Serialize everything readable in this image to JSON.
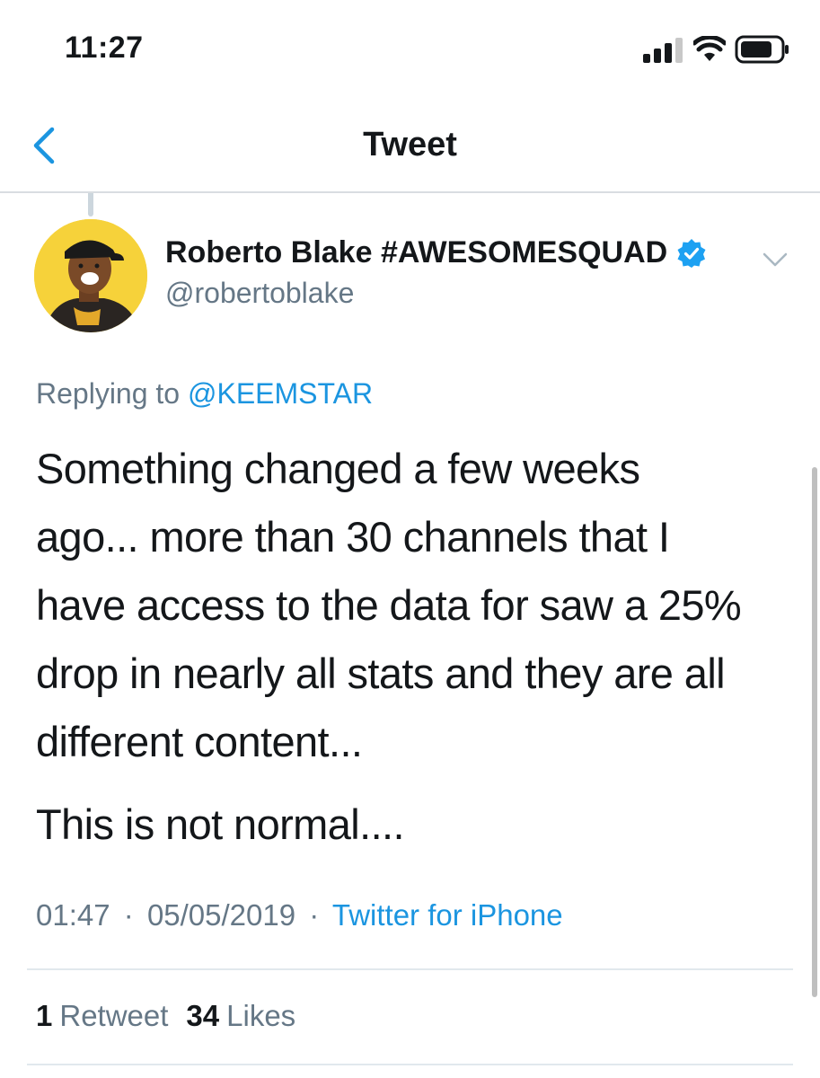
{
  "status_bar": {
    "time": "11:27",
    "icons": [
      "signal-icon",
      "wifi-icon",
      "battery-icon"
    ]
  },
  "nav": {
    "title": "Tweet",
    "back_icon": "back-chevron-icon"
  },
  "tweet": {
    "author": {
      "display_name": "Roberto Blake #AWESOMESQUAD",
      "handle": "@robertoblake",
      "verified": true
    },
    "replying_prefix": "Replying to",
    "replying_to": "@KEEMSTAR",
    "text_paragraph_1": "Something changed a few weeks\nago... more than 30 channels that I\nhave access to the data for saw a 25%\ndrop in nearly all stats and they are all\ndifferent content...",
    "text_paragraph_2": "This is not normal....",
    "time": "01:47",
    "separator": "·",
    "date": "05/05/2019",
    "source": "Twitter for iPhone",
    "stats": {
      "retweets_count": "1",
      "retweets_label": "Retweet",
      "likes_count": "34",
      "likes_label": "Likes"
    }
  },
  "colors": {
    "accent": "#1b95e0",
    "verified": "#1da1f2",
    "secondary_text": "#657786",
    "avatar_bg": "#f6d23a"
  }
}
